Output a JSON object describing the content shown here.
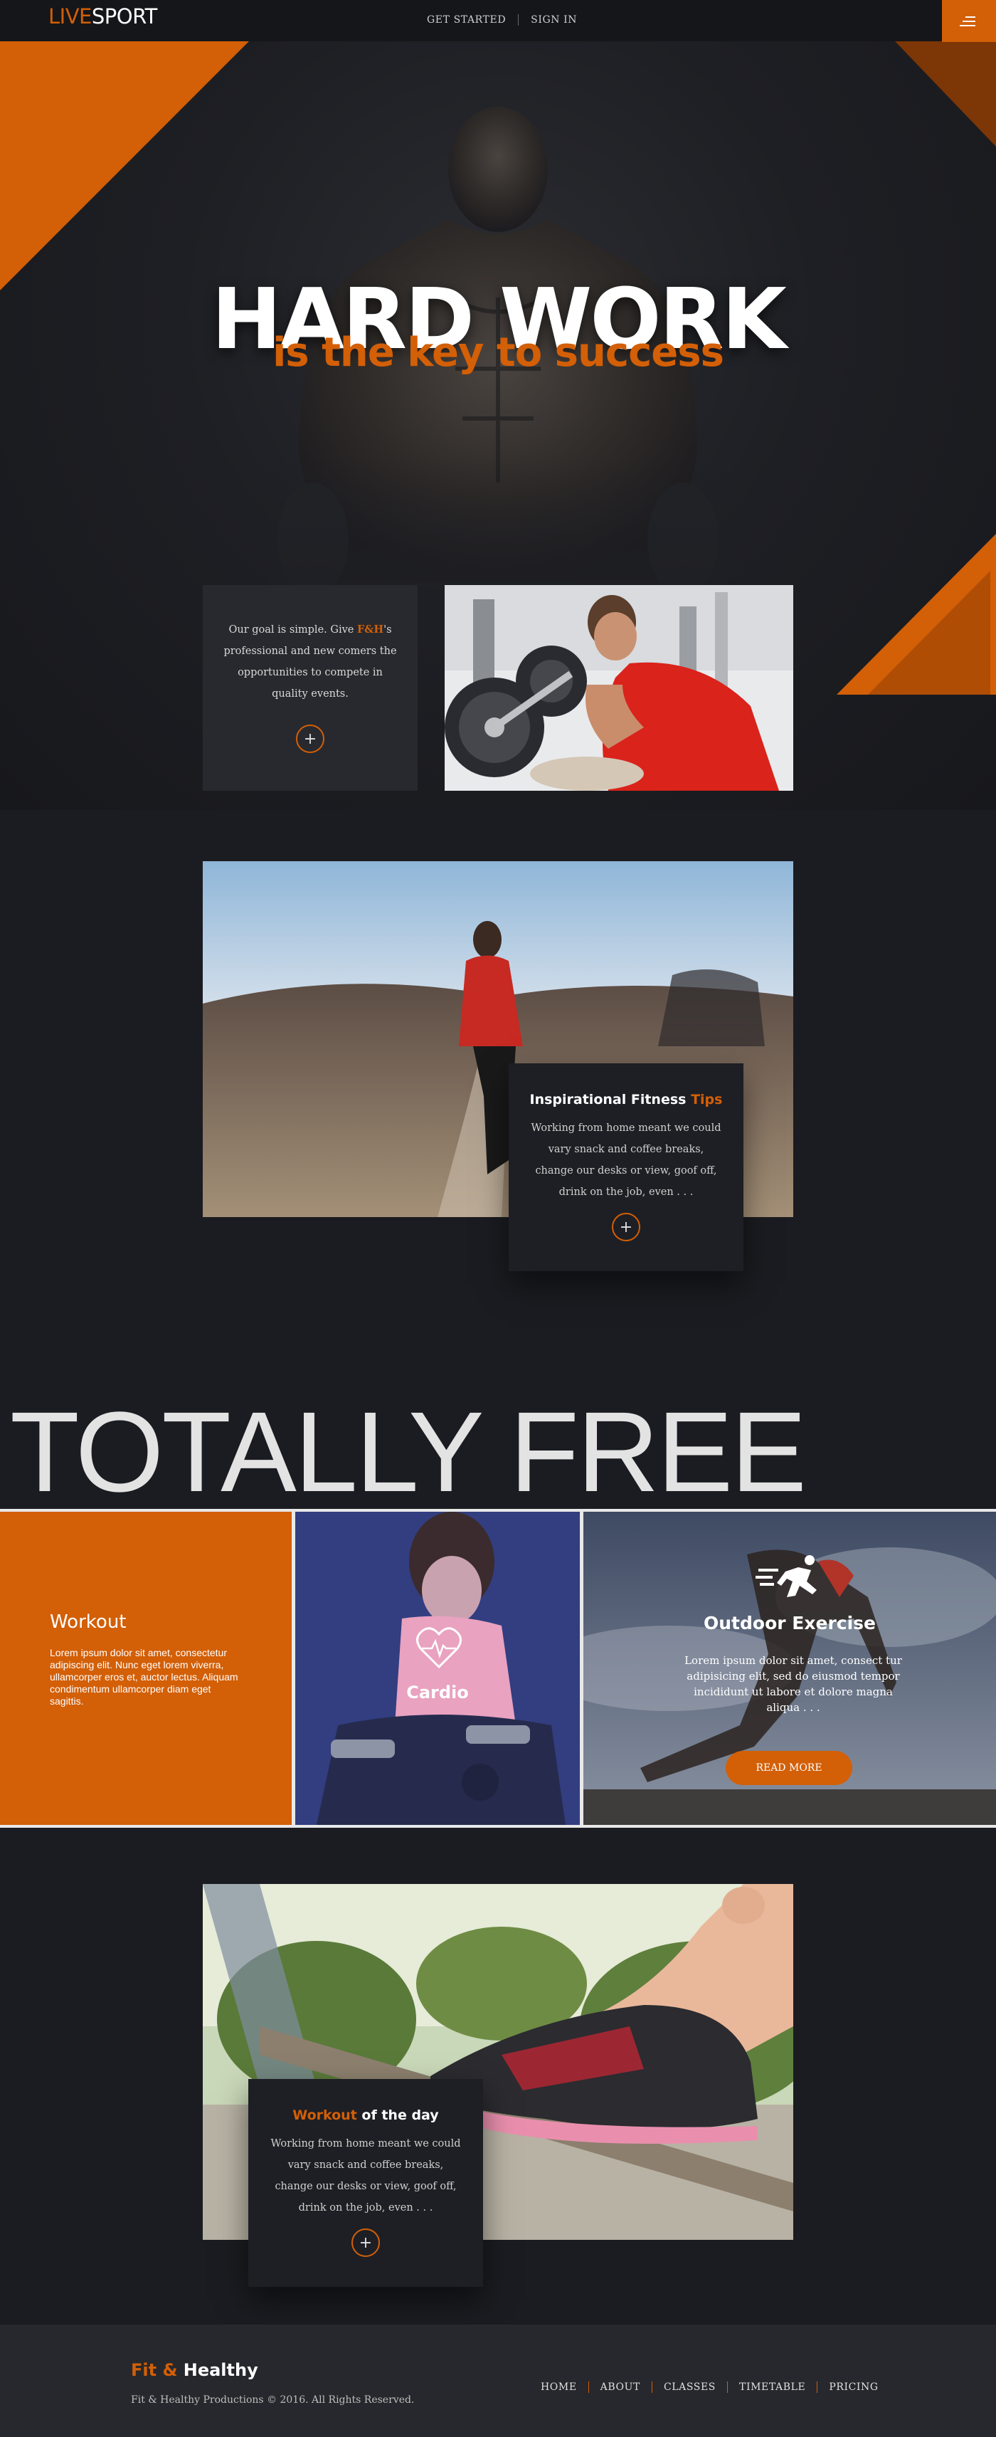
{
  "header": {
    "logo_part1": "LIVE",
    "logo_part2": "SPORT",
    "nav": [
      "GET STARTED",
      "SIGN IN"
    ],
    "menu_icon": "hamburger-icon"
  },
  "hero": {
    "title": "HARD WORK",
    "subtitle": "is the key to success"
  },
  "intro": {
    "text_before": "Our goal is simple. Give ",
    "highlight": "F&H",
    "text_after": "'s professional and new comers the opportunities to compete in quality events.",
    "more_icon": "plus-icon"
  },
  "fitness_card": {
    "title_main": "Inspirational Fitness ",
    "title_accent": "Tips",
    "text": "Working from home meant we could vary snack and coffee breaks, change our desks or view, goof off, drink on the job, even  . . .",
    "more_icon": "plus-icon"
  },
  "free_section": {
    "heading": "TOTALLY FREE",
    "workout": {
      "title": "Workout",
      "text": "Lorem ipsum dolor sit amet, consectetur adipiscing elit. Nunc eget lorem viverra, ullamcorper eros et, auctor lectus. Aliquam condimentum ullamcorper diam eget sagittis."
    },
    "cardio": {
      "title": "Cardio",
      "icon": "heartbeat-icon"
    },
    "outdoor": {
      "title": "Outdoor Exercise",
      "icon": "running-man-icon",
      "text": "Lorem ipsum dolor sit amet, consect tur adipisicing elit, sed do eiusmod tempor incididunt ut labore et dolore magna aliqua . . .",
      "button": "READ MORE"
    }
  },
  "wod_card": {
    "title_accent": "Workout",
    "title_main": " of the day",
    "text": "Working from home meant we could vary snack and coffee breaks, change our desks or view, goof off, drink on the job, even  . . .",
    "more_icon": "plus-icon"
  },
  "footer": {
    "brand_part1": "Fit & ",
    "brand_part2": "Healthy",
    "copyright": "Fit & Healthy Productions © 2016. All Rights Reserved.",
    "nav": [
      "HOME",
      "ABOUT",
      "CLASSES",
      "TIMETABLE",
      "PRICING"
    ]
  },
  "colors": {
    "accent": "#d35f07",
    "background": "#1b1c21",
    "card": "#28292e",
    "footer": "#27282d"
  }
}
